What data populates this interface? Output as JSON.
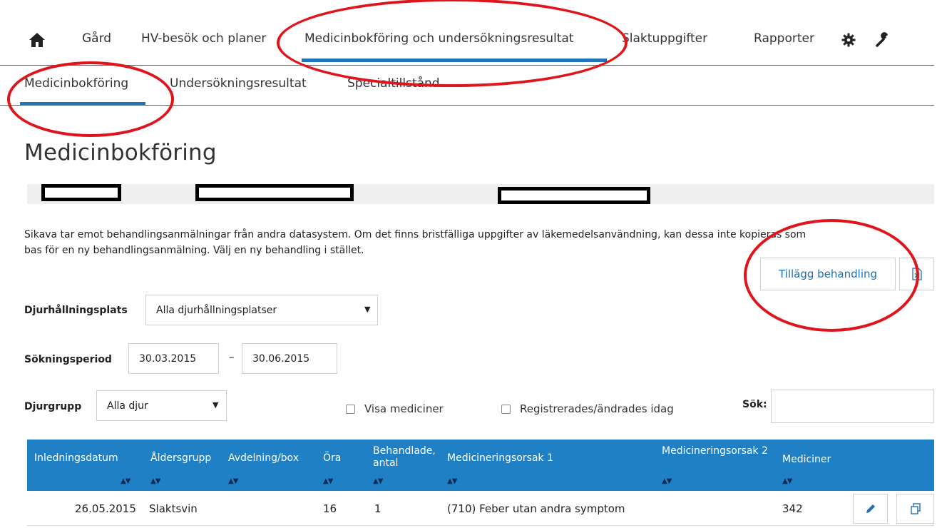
{
  "nav": {
    "items": [
      "Gård",
      "HV-besök och planer",
      "Medicinbokföring och undersökningsresultat",
      "Slaktuppgifter",
      "Rapporter"
    ]
  },
  "subnav": {
    "items": [
      "Medicinbokföring",
      "Undersökningsresultat",
      "Specialtillstånd"
    ]
  },
  "page": {
    "title": "Medicinbokföring",
    "info_line1": "Sikava tar emot behandlingsanmälningar från andra datasystem. Om det finns bristfälliga uppgifter av läkemedelsanvändning, kan dessa inte kopieras som",
    "info_line2": "bas för en ny behandlingsanmälning. Välj en ny behandling i stället.",
    "add_button": "Tillägg behandling"
  },
  "filters": {
    "location_label": "Djurhållningsplats",
    "location_value": "Alla djurhållningsplatser",
    "period_label": "Sökningsperiod",
    "period_from": "30.03.2015",
    "period_sep": "–",
    "period_to": "30.06.2015",
    "group_label": "Djurgrupp",
    "group_value": "Alla djur",
    "show_medicines": "Visa mediciner",
    "registered_today": "Registrerades/ändrades idag",
    "search_label": "Sök:"
  },
  "table": {
    "headers": [
      "Inledningsdatum",
      "Åldersgrupp",
      "Avdelning/box",
      "Öra",
      "Behandlade, antal",
      "Medicineringsorsak 1",
      "Medicineringsorsak 2",
      "Mediciner"
    ],
    "rows": [
      [
        "26.05.2015",
        "Slaktsvin",
        "",
        "16",
        "1",
        "(710) Feber utan andra symptom",
        "",
        "342"
      ]
    ]
  },
  "colors": {
    "accent": "#1f75b7",
    "header_bg": "#1f80c6",
    "annotation": "#e0141b"
  }
}
